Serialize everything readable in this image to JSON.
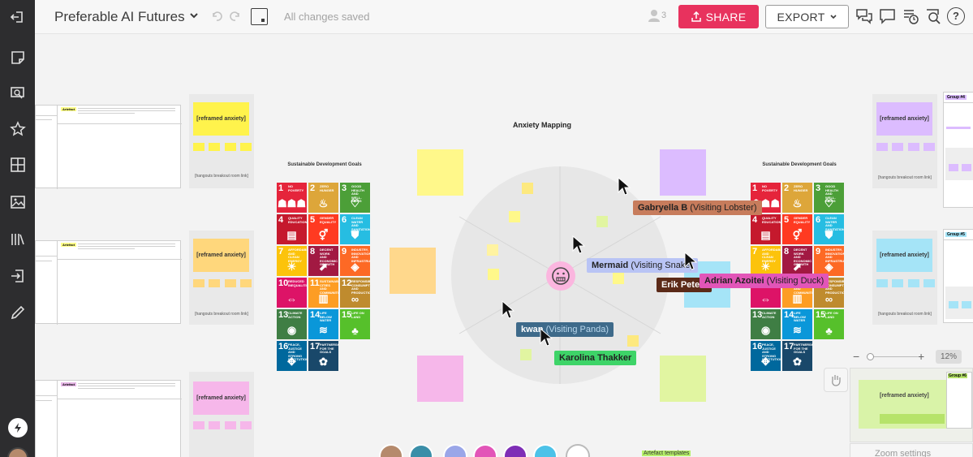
{
  "topbar": {
    "title": "Preferable AI Futures",
    "saved": "All changes saved",
    "share_label": "SHARE",
    "export_label": "EXPORT",
    "users_count": "3"
  },
  "colors": {
    "accent": "#e8325e",
    "sidebar": "#2d2d2f"
  },
  "sidebar": {
    "items": [
      "collapse-icon",
      "sticky-note-icon",
      "comment-search-icon",
      "star-icon",
      "template-grid-icon",
      "image-icon",
      "library-icon",
      "import-icon",
      "pen-icon",
      "lightning-icon"
    ]
  },
  "board": {
    "center_title": "Anxiety Mapping",
    "sdg_title": "Sustainable Development Goals",
    "reframed": "[reframed anxiety]",
    "hangouts": "[hangouts breakout room link]",
    "artefact": "Artefact",
    "group4": "Group #4",
    "group5": "Group #5",
    "group6": "Group #6",
    "artefact_templates": "Artefact templates",
    "zoom": "12%",
    "zoom_settings": "Zoom settings"
  },
  "sdg": [
    {
      "n": "1",
      "t": "NO POVERTY",
      "c": "#e5243b",
      "g": "☗☗☗"
    },
    {
      "n": "2",
      "t": "ZERO HUNGER",
      "c": "#dda63a",
      "g": "♨"
    },
    {
      "n": "3",
      "t": "GOOD HEALTH AND WELL-BEING",
      "c": "#4c9f38",
      "g": "♡"
    },
    {
      "n": "4",
      "t": "QUALITY EDUCATION",
      "c": "#c5192d",
      "g": "▤"
    },
    {
      "n": "5",
      "t": "GENDER EQUALITY",
      "c": "#ff3a21",
      "g": "⚥"
    },
    {
      "n": "6",
      "t": "CLEAN WATER AND SANITATION",
      "c": "#26bde2",
      "g": "⛊"
    },
    {
      "n": "7",
      "t": "AFFORDABLE AND CLEAN ENERGY",
      "c": "#fcc30b",
      "g": "☀"
    },
    {
      "n": "8",
      "t": "DECENT WORK AND ECONOMIC GROWTH",
      "c": "#a21942",
      "g": "⬈"
    },
    {
      "n": "9",
      "t": "INDUSTRY, INNOVATION AND INFRASTRUCTURE",
      "c": "#fd6925",
      "g": "◈"
    },
    {
      "n": "10",
      "t": "REDUCED INEQUALITIES",
      "c": "#dd1367",
      "g": "⇔"
    },
    {
      "n": "11",
      "t": "SUSTAINABLE CITIES AND COMMUNITIES",
      "c": "#fd9d24",
      "g": "▥"
    },
    {
      "n": "12",
      "t": "RESPONSIBLE CONSUMPTION AND PRODUCTION",
      "c": "#bf8b2e",
      "g": "∞"
    },
    {
      "n": "13",
      "t": "CLIMATE ACTION",
      "c": "#3f7e44",
      "g": "◉"
    },
    {
      "n": "14",
      "t": "LIFE BELOW WATER",
      "c": "#0a97d9",
      "g": "≋"
    },
    {
      "n": "15",
      "t": "LIFE ON LAND",
      "c": "#56c02b",
      "g": "♣"
    },
    {
      "n": "16",
      "t": "PEACE, JUSTICE AND STRONG INSTITUTIONS",
      "c": "#00689d",
      "g": "✥"
    },
    {
      "n": "17",
      "t": "PARTNERSHIPS FOR THE GOALS",
      "c": "#19486a",
      "g": "✿"
    }
  ],
  "cursors": [
    {
      "name": "Gabryella B",
      "visit": "(Visiting Lobster)",
      "color": "#c77c5c"
    },
    {
      "name": "Mermaid",
      "visit": "(Visiting Snake)",
      "color": "#b9c4f5"
    },
    {
      "name": "Erik Petersen",
      "visit": "",
      "color": "#5b2a18",
      "short": "Erik Pete"
    },
    {
      "name": "Adrian Azoitei",
      "visit": "(Visiting Duck)",
      "color": "#e255b8"
    },
    {
      "name": "kwan",
      "visit": "(Visiting Panda)",
      "color": "#3e6a8a"
    },
    {
      "name": "Karolina Thakker",
      "visit": "",
      "color": "#3ed468"
    }
  ]
}
